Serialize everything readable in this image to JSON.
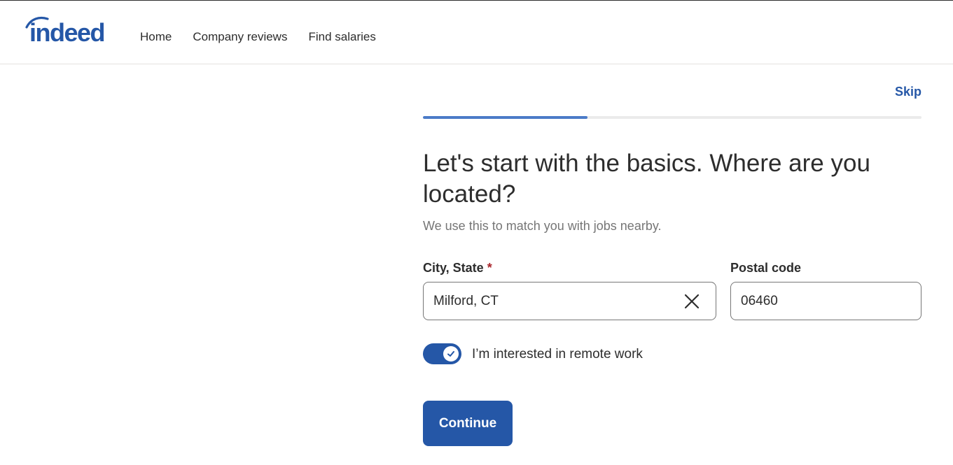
{
  "brand": {
    "logo_text": "indeed",
    "brand_color": "#2557a7"
  },
  "nav": {
    "items": [
      {
        "label": "Home"
      },
      {
        "label": "Company reviews"
      },
      {
        "label": "Find salaries"
      }
    ]
  },
  "onboarding": {
    "skip_label": "Skip",
    "progress_fraction": 0.33,
    "title": "Let's start with the basics. Where are you located?",
    "subtitle": "We use this to match you with jobs nearby.",
    "city_field": {
      "label": "City, State",
      "required_marker": "*",
      "value": "Milford, CT",
      "clear_icon": "close-icon"
    },
    "postal_field": {
      "label": "Postal code",
      "value": "06460"
    },
    "remote_toggle": {
      "label": "I’m interested in remote work",
      "checked": true,
      "icon": "check-icon"
    },
    "continue_label": "Continue"
  },
  "colors": {
    "accent": "#2557a7",
    "progress": "#4b7bc8",
    "required": "#a9252b",
    "muted_text": "#767676"
  }
}
